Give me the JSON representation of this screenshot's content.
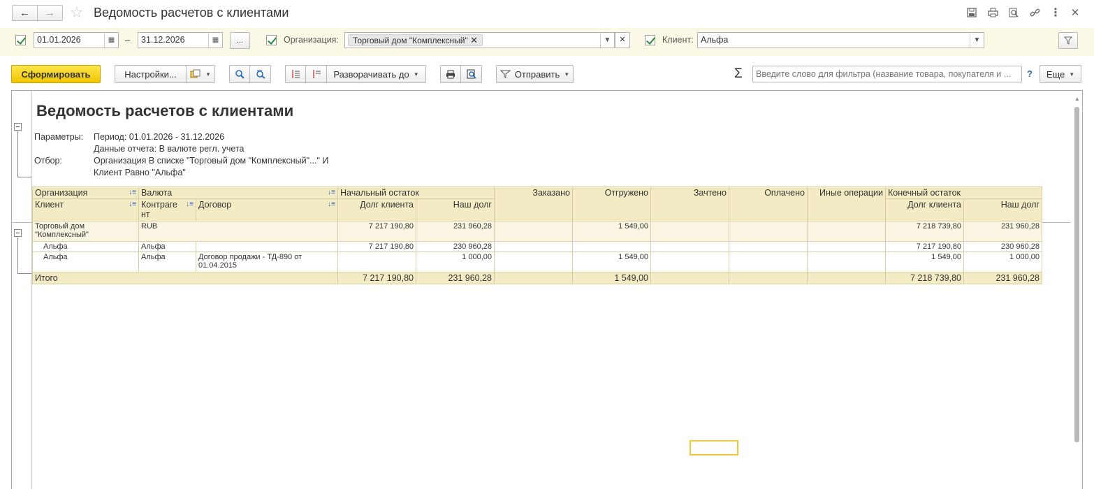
{
  "window": {
    "title": "Ведомость расчетов с клиентами"
  },
  "filters": {
    "date_from": "01.01.2026",
    "date_dash": "–",
    "date_to": "31.12.2026",
    "dots_label": "...",
    "org_label": "Организация:",
    "org_tag": "Торговый дом \"Комплексный\"",
    "client_label": "Клиент:",
    "client_value": "Альфа"
  },
  "toolbar": {
    "generate": "Сформировать",
    "settings": "Настройки...",
    "expand_to": "Разворачивать до",
    "send": "Отправить",
    "sigma": "Σ",
    "filter_placeholder": "Введите слово для фильтра (название товара, покупателя и ...",
    "help": "?",
    "more": "Еще"
  },
  "report": {
    "title": "Ведомость расчетов с клиентами",
    "params_label": "Параметры:",
    "param_period": "Период: 01.01.2026 - 31.12.2026",
    "param_data": "Данные отчета: В валюте регл. учета",
    "filter_label": "Отбор:",
    "filter_line1": "Организация В списке \"Торговый дом \"Комплексный\"...\" И",
    "filter_line2": "Клиент Равно \"Альфа\""
  },
  "table": {
    "h_org": "Организация",
    "h_currency": "Валюта",
    "h_opening": "Начальный остаток",
    "h_ordered": "Заказано",
    "h_shipped": "Отгружено",
    "h_offset": "Зачтено",
    "h_paid": "Оплачено",
    "h_other": "Иные операции",
    "h_closing": "Конечный остаток",
    "h_client": "Клиент",
    "h_counterparty": "Контраге нт",
    "h_contract": "Договор",
    "h_client_debt": "Долг клиента",
    "h_our_debt": "Наш долг",
    "group": {
      "org": "Торговый дом \"Комплексный\"",
      "currency": "RUB",
      "open_client": "7 217 190,80",
      "open_our": "231 960,28",
      "shipped": "1 549,00",
      "close_client": "7 218 739,80",
      "close_our": "231 960,28"
    },
    "rows": [
      {
        "client": "Альфа",
        "cp": "Альфа",
        "contract": "",
        "open_client": "7 217 190,80",
        "open_our": "230 960,28",
        "shipped": "",
        "close_client": "7 217 190,80",
        "close_our": "230 960,28"
      },
      {
        "client": "Альфа",
        "cp": "Альфа",
        "contract": "Договор продажи - ТД-890 от 01.04.2015",
        "open_client": "",
        "open_our": "1 000,00",
        "shipped": "1 549,00",
        "close_client": "1 549,00",
        "close_our": "1 000,00"
      }
    ],
    "total": {
      "label": "Итого",
      "open_client": "7 217 190,80",
      "open_our": "231 960,28",
      "shipped": "1 549,00",
      "close_client": "7 218 739,80",
      "close_our": "231 960,28"
    }
  }
}
